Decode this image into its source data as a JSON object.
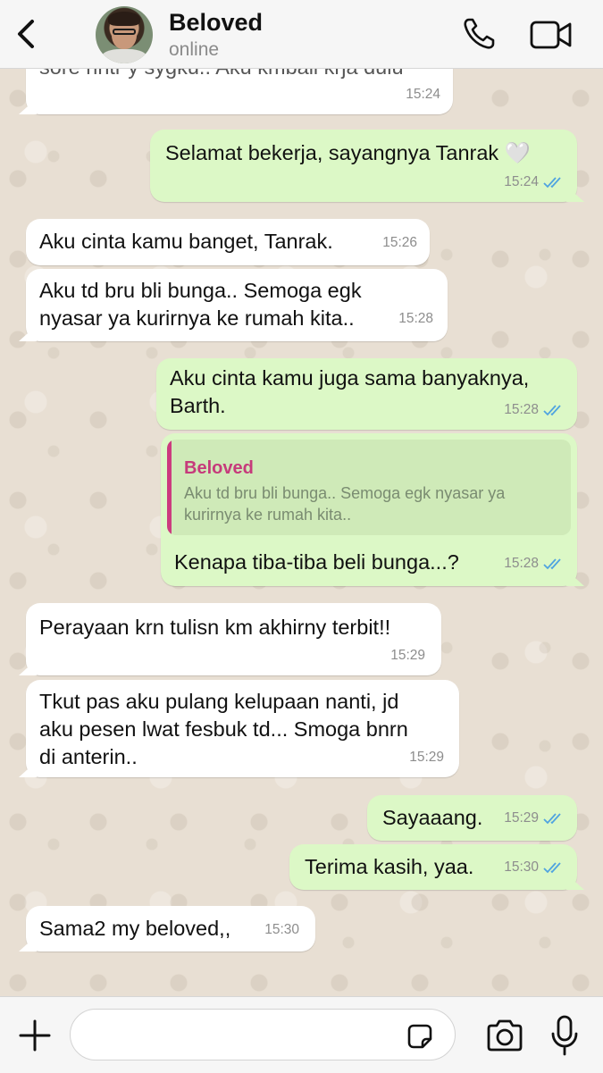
{
  "header": {
    "contact_name": "Beloved",
    "status": "online",
    "back_icon": "chevron-left-icon",
    "call_icon": "phone-icon",
    "video_icon": "video-camera-icon"
  },
  "messages": [
    {
      "direction": "in",
      "text": "sore nntr y sygku.. Aku kmbali krja dulu",
      "time": "15:24"
    },
    {
      "direction": "out",
      "text": "Selamat bekerja, sayangnya Tanrak 🤍",
      "time": "15:24",
      "status": "read"
    },
    {
      "direction": "in",
      "text": "Aku cinta kamu banget, Tanrak.",
      "time": "15:26"
    },
    {
      "direction": "in",
      "text": "Aku td bru bli bunga.. Semoga egk\nnyasar ya kurirnya ke rumah kita..",
      "time": "15:28"
    },
    {
      "direction": "out",
      "text": "Aku cinta kamu juga sama banyaknya,\nBarth.",
      "time": "15:28",
      "status": "read"
    },
    {
      "direction": "out",
      "text": "Kenapa tiba-tiba beli bunga...?",
      "time": "15:28",
      "status": "read",
      "reply_to": {
        "author": "Beloved",
        "text": "Aku td bru bli bunga.. Semoga egk nyasar ya kurirnya ke rumah kita.."
      }
    },
    {
      "direction": "in",
      "text": "Perayaan krn tulisn km akhirny terbit!!",
      "time": "15:29"
    },
    {
      "direction": "in",
      "text": "Tkut pas aku pulang kelupaan nanti, jd\naku pesen lwat fesbuk td... Smoga bnrn\ndi anterin..",
      "time": "15:29"
    },
    {
      "direction": "out",
      "text": "Sayaaang.",
      "time": "15:29",
      "status": "read"
    },
    {
      "direction": "out",
      "text": "Terima kasih, yaa.",
      "time": "15:30",
      "status": "read"
    },
    {
      "direction": "in",
      "text": "Sama2 my beloved,,",
      "time": "15:30"
    }
  ],
  "composer": {
    "value": "",
    "plus_icon": "plus-icon",
    "sticker_icon": "sticker-icon",
    "camera_icon": "camera-icon",
    "mic_icon": "microphone-icon"
  },
  "colors": {
    "outgoing_bubble": "#dcf8c6",
    "incoming_bubble": "#ffffff",
    "read_ticks": "#4fa3e0",
    "reply_accent": "#c63a7b"
  }
}
